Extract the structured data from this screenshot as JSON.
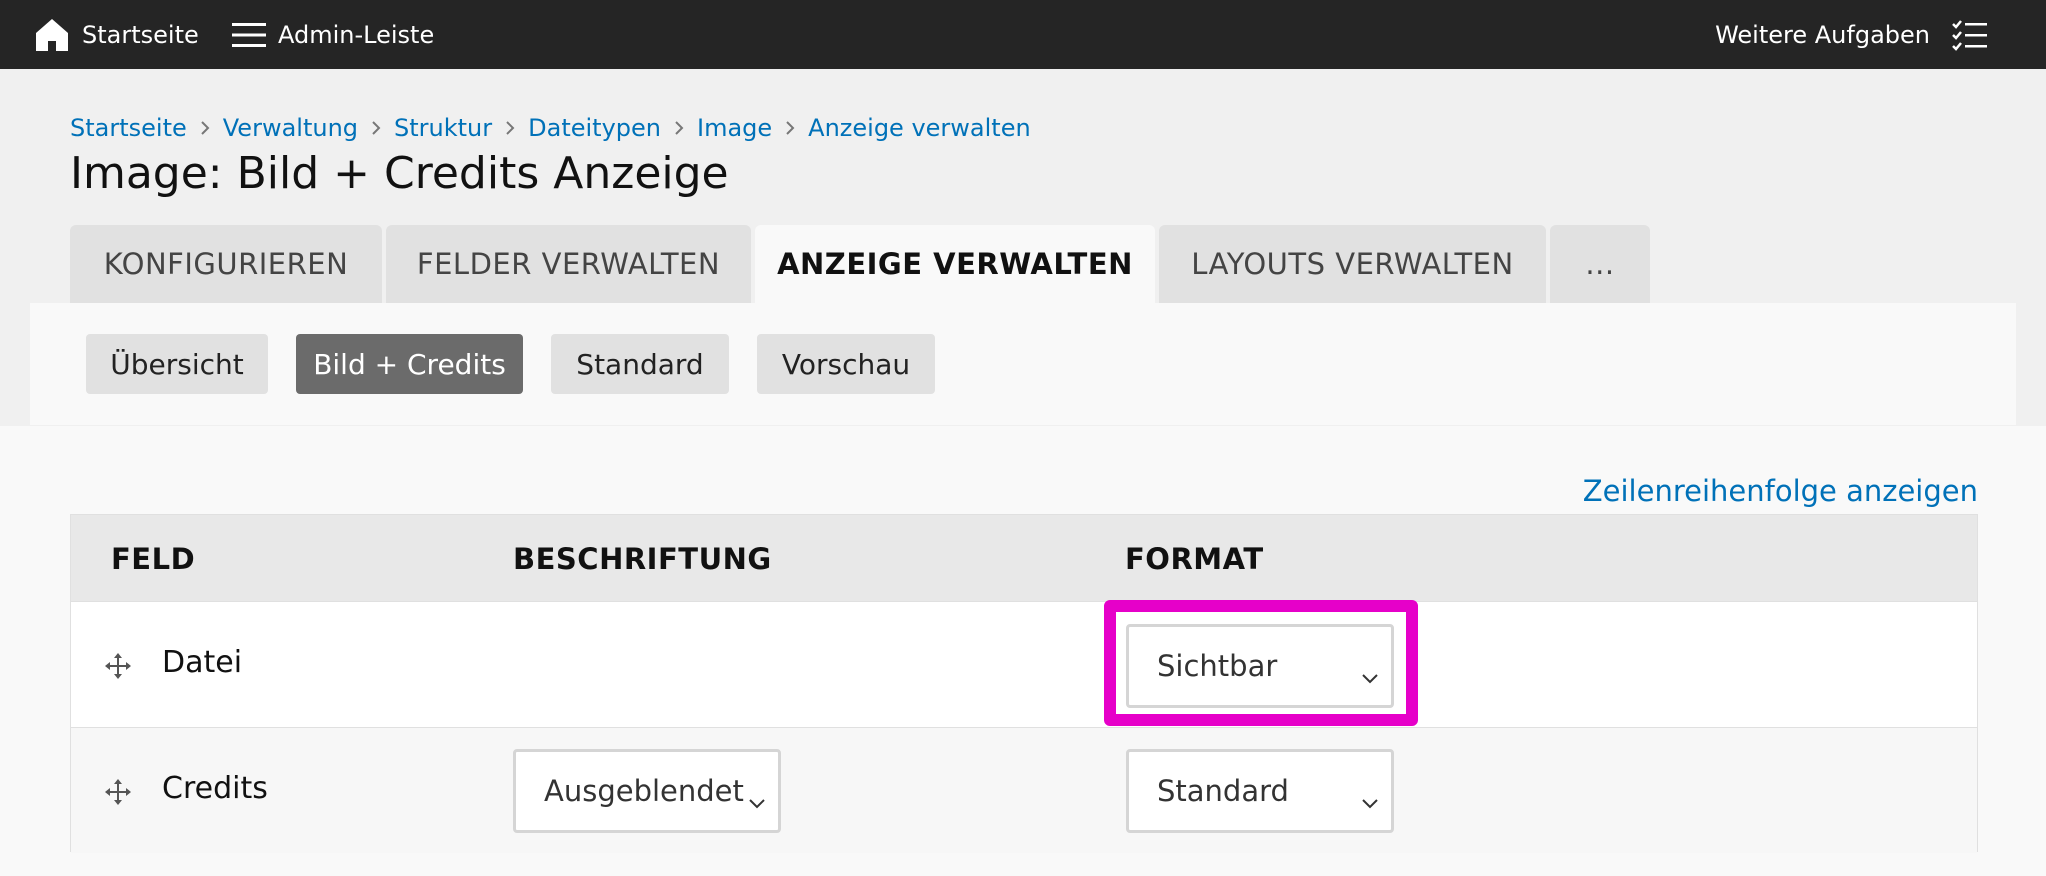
{
  "toolbar": {
    "home_label": "Startseite",
    "admin_label": "Admin-Leiste",
    "tasks_label": "Weitere Aufgaben",
    "icons": [
      "home-icon",
      "hamburger-menu-icon",
      "task-list-icon"
    ]
  },
  "breadcrumb": {
    "items": [
      "Startseite",
      "Verwaltung",
      "Struktur",
      "Dateitypen",
      "Image",
      "Anzeige verwalten"
    ]
  },
  "page": {
    "title": "Image: Bild + Credits Anzeige"
  },
  "tabs": [
    {
      "label": "KONFIGURIEREN",
      "active": false
    },
    {
      "label": "FELDER VERWALTEN",
      "active": false
    },
    {
      "label": "ANZEIGE VERWALTEN",
      "active": true
    },
    {
      "label": "LAYOUTS VERWALTEN",
      "active": false
    },
    {
      "label": "...",
      "active": false
    }
  ],
  "subtabs": [
    {
      "label": "Übersicht",
      "active": false
    },
    {
      "label": "Bild + Credits",
      "active": true
    },
    {
      "label": "Standard",
      "active": false
    },
    {
      "label": "Vorschau",
      "active": false
    }
  ],
  "row_weights_link": "Zeilenreihenfolge anzeigen",
  "table": {
    "headers": [
      "FELD",
      "BESCHRIFTUNG",
      "FORMAT"
    ],
    "rows": [
      {
        "field": "Datei",
        "label_select": "",
        "format_select": "Sichtbar"
      },
      {
        "field": "Credits",
        "label_select": "Ausgeblendet",
        "format_select": "Standard"
      }
    ]
  },
  "colors": {
    "toolbar_bg": "#252525",
    "link": "#0071b8",
    "active_subtab": "#6b6b6b",
    "highlight": "#e600c9"
  }
}
